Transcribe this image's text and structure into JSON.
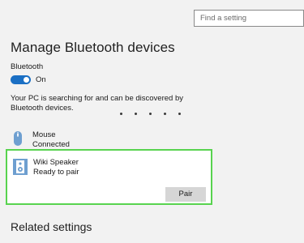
{
  "search": {
    "placeholder": "Find a setting"
  },
  "page": {
    "title": "Manage Bluetooth devices"
  },
  "bluetooth": {
    "label": "Bluetooth",
    "toggle_state": "On",
    "status_text": "Your PC is searching for and can be discovered by Bluetooth devices."
  },
  "devices": [
    {
      "name": "Mouse",
      "status": "Connected",
      "icon": "mouse-icon"
    },
    {
      "name": "Wiki Speaker",
      "status": "Ready to pair",
      "icon": "speaker-icon",
      "action_label": "Pair"
    }
  ],
  "related": {
    "title": "Related settings"
  },
  "colors": {
    "accent": "#1a6fc4",
    "highlight": "#58d34f",
    "icon": "#6e9fd0"
  }
}
